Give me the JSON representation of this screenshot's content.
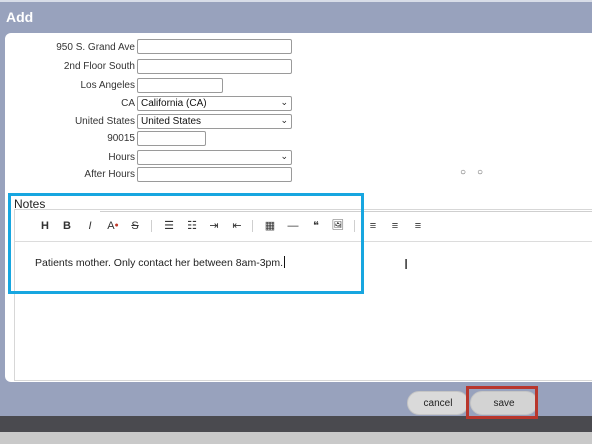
{
  "dialog": {
    "title": "Add"
  },
  "form": {
    "rows": [
      {
        "label": "950 S. Grand Ave",
        "value": "",
        "type": "text"
      },
      {
        "label": "2nd Floor South",
        "value": "",
        "type": "text"
      },
      {
        "label": "Los Angeles",
        "value": "",
        "type": "text"
      },
      {
        "label": "CA",
        "value": "California (CA)",
        "type": "select"
      },
      {
        "label": "United States",
        "value": "United States",
        "type": "select"
      },
      {
        "label": "90015",
        "value": "",
        "type": "text"
      },
      {
        "label": "Hours",
        "value": "",
        "type": "select"
      },
      {
        "label": "After Hours",
        "value": "",
        "type": "text"
      }
    ]
  },
  "notes": {
    "label": "Notes",
    "text": "Patients mother. Only contact her between 8am-3pm.",
    "toolbar": [
      {
        "glyph": "H",
        "icon": "heading-icon"
      },
      {
        "glyph": "B",
        "icon": "bold-icon"
      },
      {
        "glyph": "I",
        "icon": "italic-icon"
      },
      {
        "glyph": "A",
        "icon": "text-color-icon"
      },
      {
        "glyph": "S",
        "icon": "strikethrough-icon"
      },
      {
        "glyph": "☰",
        "icon": "bullet-list-icon"
      },
      {
        "glyph": "☷",
        "icon": "numbered-list-icon"
      },
      {
        "glyph": "⇥",
        "icon": "indent-icon"
      },
      {
        "glyph": "⇤",
        "icon": "outdent-icon"
      },
      {
        "glyph": "▦",
        "icon": "table-icon"
      },
      {
        "glyph": "—",
        "icon": "horizontal-rule-icon"
      },
      {
        "glyph": "❝",
        "icon": "quote-icon"
      },
      {
        "glyph": "🖼",
        "icon": "image-icon"
      },
      {
        "glyph": "≡",
        "icon": "align-left-icon"
      },
      {
        "glyph": "≡",
        "icon": "align-center-icon"
      },
      {
        "glyph": "≡",
        "icon": "align-right-icon"
      }
    ]
  },
  "actions": {
    "cancel": "cancel",
    "save": "save"
  },
  "colors": {
    "highlight": "#17a6e0",
    "save_frame": "#b8362c",
    "header": "#98a2bd"
  }
}
